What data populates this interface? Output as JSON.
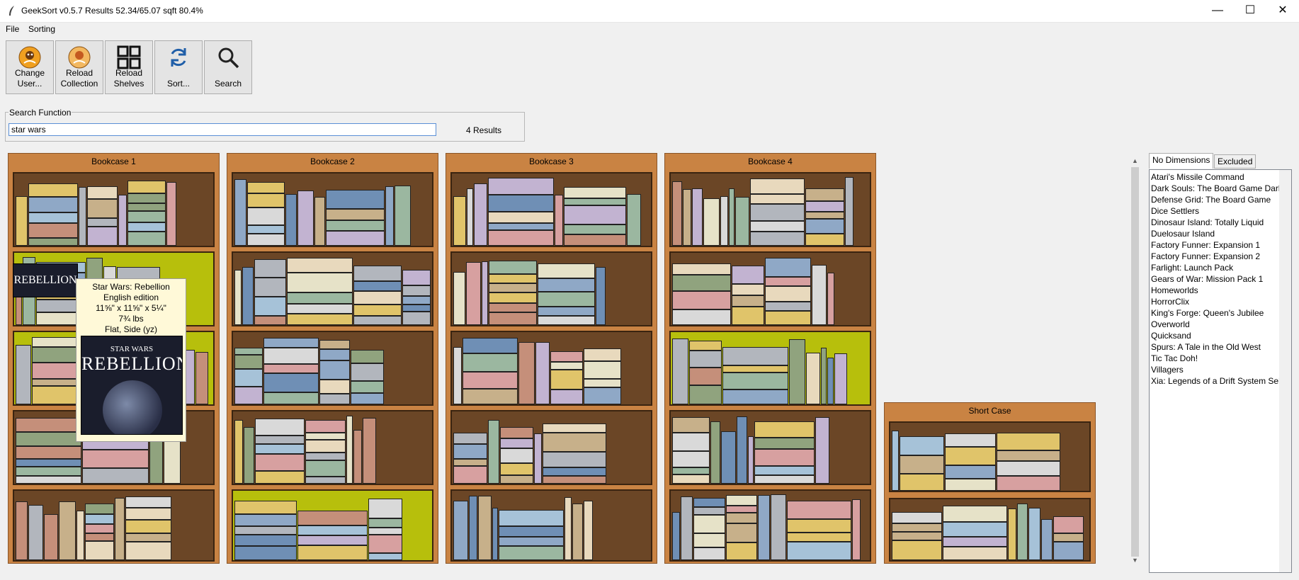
{
  "window": {
    "title": "GeekSort v0.5.7 Results 52.34/65.07 sqft 80.4%",
    "minimize": "—",
    "maximize": "☐",
    "close": "✕"
  },
  "menu": [
    "File",
    "Sorting"
  ],
  "toolbar": {
    "change_user": "Change\nUser...",
    "reload_collection": "Reload\nCollection",
    "reload_shelves": "Reload\nShelves",
    "sort": "Sort...",
    "search": "Search"
  },
  "search": {
    "legend": "Search Function",
    "value": "star wars",
    "results": "4 Results"
  },
  "bookcases": [
    {
      "title": "Bookcase 1"
    },
    {
      "title": "Bookcase 2"
    },
    {
      "title": "Bookcase 3"
    },
    {
      "title": "Bookcase 4"
    },
    {
      "title": "Short Case"
    }
  ],
  "tooltip": {
    "name": "Star Wars: Rebellion",
    "edition": "English edition",
    "dimensions": "11⅝\" x 11⅝\" x 5¼\"",
    "weight": "7¾ lbs",
    "orientation": "Flat, Side (yz)",
    "box_logo": "STAR WARS",
    "box_name": "REBELLION"
  },
  "shelf_box_label": "REBELLION",
  "side_tabs": {
    "no_dimensions": "No Dimensions",
    "excluded": "Excluded"
  },
  "no_dimensions_list": [
    "Atari's Missile Command",
    "Dark Souls: The Board Game Darki",
    "Defense Grid: The Board Game",
    "Dice Settlers",
    "Dinosaur Island: Totally Liquid",
    "Duelosaur Island",
    "Factory Funner: Expansion 1",
    "Factory Funner: Expansion 2",
    "Farlight: Launch Pack",
    "Gears of War: Mission Pack 1",
    "Homeworlds",
    "HorrorClix",
    "King's Forge: Queen's Jubilee",
    "Overworld",
    "Quicksand",
    "Spurs: A Tale in the Old West",
    "Tic Tac Doh!",
    "Villagers",
    "Xia: Legends of a Drift System Sell"
  ],
  "colors": {
    "case_wood": "#c98343",
    "shelf_back": "#6b4626",
    "highlight": "#b7bf0c"
  }
}
